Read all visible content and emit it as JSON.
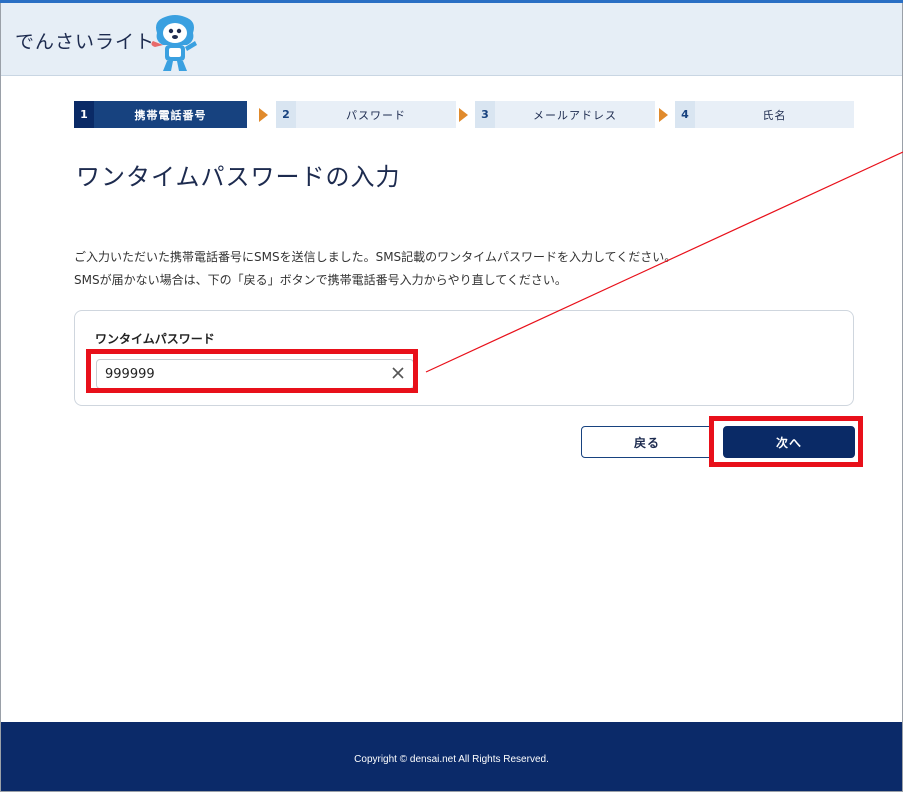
{
  "header": {
    "brand": "でんさいライト"
  },
  "stepper": {
    "steps": [
      {
        "num": "1",
        "label": "携帯電話番号"
      },
      {
        "num": "2",
        "label": "パスワード"
      },
      {
        "num": "3",
        "label": "メールアドレス"
      },
      {
        "num": "4",
        "label": "氏名"
      }
    ],
    "active_step": 1
  },
  "main": {
    "title": "ワンタイムパスワードの入力",
    "description_line1": "ご入力いただいた携帯電話番号にSMSを送信しました。SMS記載のワンタイムパスワードを入力してください。",
    "description_line2": "SMSが届かない場合は、下の「戻る」ボタンで携帯電話番号入力からやり直してください。"
  },
  "form": {
    "otp_label": "ワンタイムパスワード",
    "otp_value": "999999"
  },
  "buttons": {
    "back_label": "戻る",
    "next_label": "次へ"
  },
  "footer": {
    "copyright": "Copyright © densai.net All Rights Reserved."
  },
  "colors": {
    "primary_navy": "#0a2a66",
    "step_arrow": "#e08a2c",
    "highlight_red": "#e8101a",
    "header_bg": "#e6eef6"
  },
  "icons": {
    "clear": "close-icon",
    "mascot": "mascot-icon"
  }
}
